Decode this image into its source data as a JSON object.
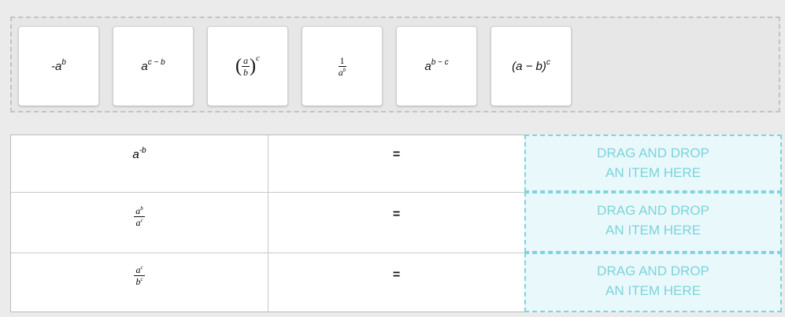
{
  "tiles": [
    {
      "base": "-a",
      "exp": "b"
    },
    {
      "base": "a",
      "exp": "c − b"
    },
    {
      "num": "a",
      "den": "b",
      "exp": "c"
    },
    {
      "num": "1",
      "den_base": "a",
      "den_exp": "b"
    },
    {
      "base": "a",
      "exp": "b − c"
    },
    {
      "base": "(a − b)",
      "exp": "c"
    }
  ],
  "rows": [
    {
      "expr_base": "a",
      "expr_exp": "-b",
      "equals": "=",
      "drop_line1": "DRAG AND DROP",
      "drop_line2": "AN ITEM HERE"
    },
    {
      "num_base": "a",
      "num_exp": "b",
      "den_base": "a",
      "den_exp": "c",
      "equals": "=",
      "drop_line1": "DRAG AND DROP",
      "drop_line2": "AN ITEM HERE"
    },
    {
      "num_base": "a",
      "num_exp": "c",
      "den_base": "b",
      "den_exp": "c",
      "equals": "=",
      "drop_line1": "DRAG AND DROP",
      "drop_line2": "AN ITEM HERE"
    }
  ]
}
